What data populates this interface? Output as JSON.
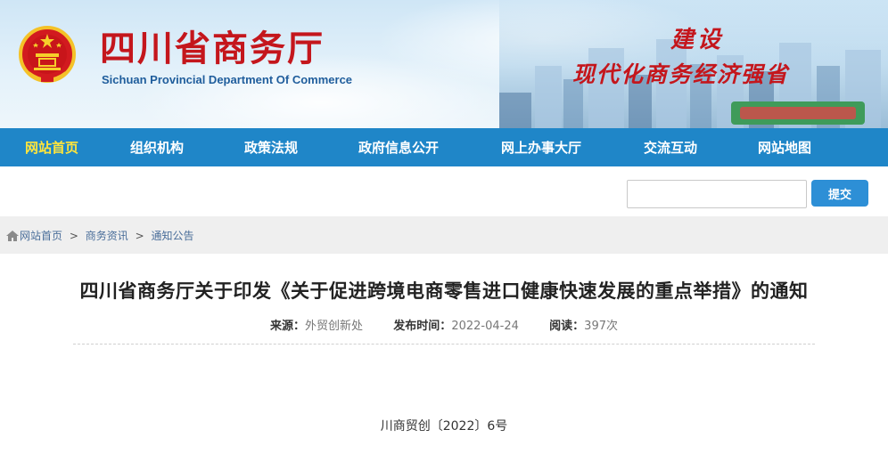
{
  "header": {
    "title": "四川省商务厅",
    "subtitle": "Sichuan Provincial Department Of Commerce",
    "slogan_line1": "建设",
    "slogan_line2": "现代化商务经济强省",
    "emblem_icon": "national-emblem-icon",
    "title_color": "#c4161c"
  },
  "nav": {
    "items": [
      {
        "label": "网站首页",
        "active": true
      },
      {
        "label": "组织机构"
      },
      {
        "label": "政策法规"
      },
      {
        "label": "政府信息公开"
      },
      {
        "label": "网上办事大厅"
      },
      {
        "label": "交流互动"
      },
      {
        "label": "网站地图"
      }
    ],
    "background": "#1f86c8",
    "active_color": "#ffe53b"
  },
  "search": {
    "value": "",
    "placeholder": "",
    "button_label": "提交"
  },
  "breadcrumb": {
    "icon": "home-icon",
    "items": [
      "网站首页",
      "商务资讯",
      "通知公告"
    ],
    "separator": ">"
  },
  "article": {
    "title": "四川省商务厅关于印发《关于促进跨境电商零售进口健康快速发展的重点举措》的通知",
    "source_label": "来源：",
    "source_value": "外贸创新处",
    "date_label": "发布时间：",
    "date_value": "2022-04-24",
    "views_label": "阅读：",
    "views_value": "397次",
    "doc_number": "川商贸创〔2022〕6号"
  }
}
